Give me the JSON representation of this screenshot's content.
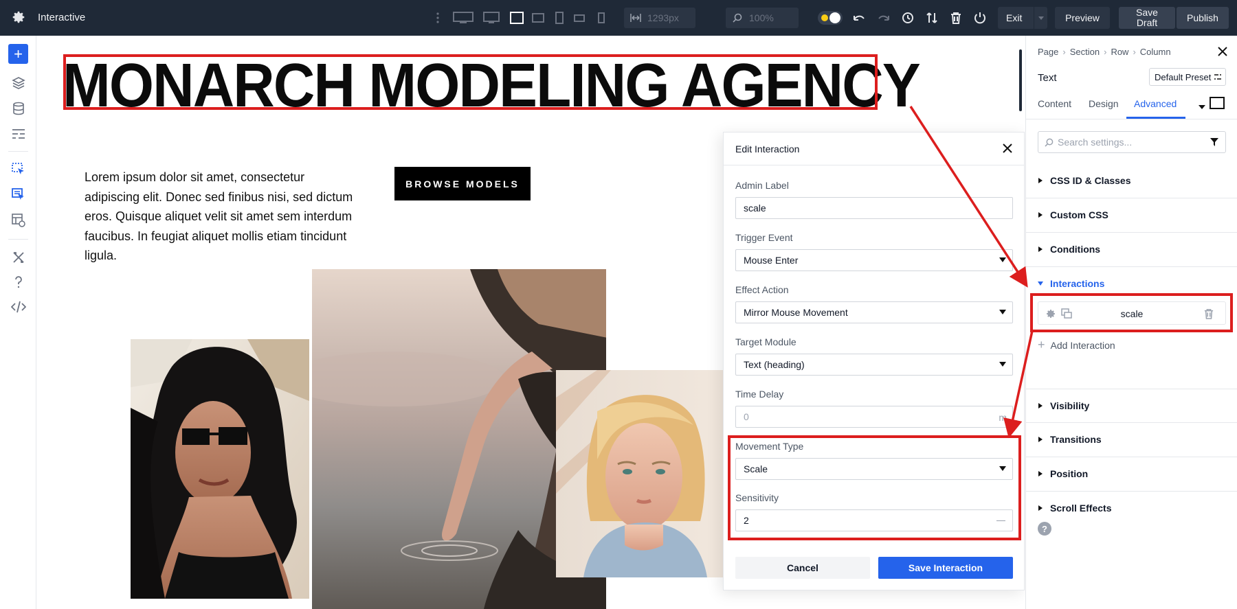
{
  "app": {
    "title": "Interactive"
  },
  "toolbar": {
    "width_value": "1293px",
    "zoom_value": "100%",
    "exit_label": "Exit",
    "preview_label": "Preview",
    "save_draft_label": "Save\nDraft",
    "publish_label": "Publish"
  },
  "canvas": {
    "heading": "MONARCH MODELING AGENCY",
    "body_text": "Lorem ipsum dolor sit amet, consectetur adipiscing elit. Donec sed finibus nisi, sed dictum eros. Quisque aliquet velit sit amet sem interdum faucibus. In feugiat aliquet mollis etiam tincidunt ligula.",
    "button_label": "BROWSE MODELS"
  },
  "modal": {
    "title": "Edit Interaction",
    "admin_label": {
      "label": "Admin Label",
      "value": "scale"
    },
    "trigger_event": {
      "label": "Trigger Event",
      "value": "Mouse Enter"
    },
    "effect_action": {
      "label": "Effect Action",
      "value": "Mirror Mouse Movement"
    },
    "target_module": {
      "label": "Target Module",
      "value": "Text (heading)"
    },
    "time_delay": {
      "label": "Time Delay",
      "placeholder": "0",
      "unit": "m"
    },
    "movement_type": {
      "label": "Movement Type",
      "value": "Scale"
    },
    "sensitivity": {
      "label": "Sensitivity",
      "value": "2"
    },
    "cancel_label": "Cancel",
    "save_label": "Save Interaction"
  },
  "settings": {
    "breadcrumb": [
      "Page",
      "Section",
      "Row",
      "Column"
    ],
    "module_name": "Text",
    "preset": "Default Preset",
    "tabs": [
      "Content",
      "Design",
      "Advanced"
    ],
    "active_tab": "Advanced",
    "search_placeholder": "Search settings...",
    "sections": {
      "css": "CSS ID & Classes",
      "custom_css": "Custom CSS",
      "conditions": "Conditions",
      "interactions": "Interactions",
      "visibility": "Visibility",
      "transitions": "Transitions",
      "position": "Position",
      "scroll_effects": "Scroll Effects"
    },
    "interaction_item": "scale",
    "add_interaction": "Add Interaction"
  },
  "colors": {
    "accent": "#2563eb",
    "highlight": "#dc1e1e",
    "topbar": "#1f2937"
  }
}
